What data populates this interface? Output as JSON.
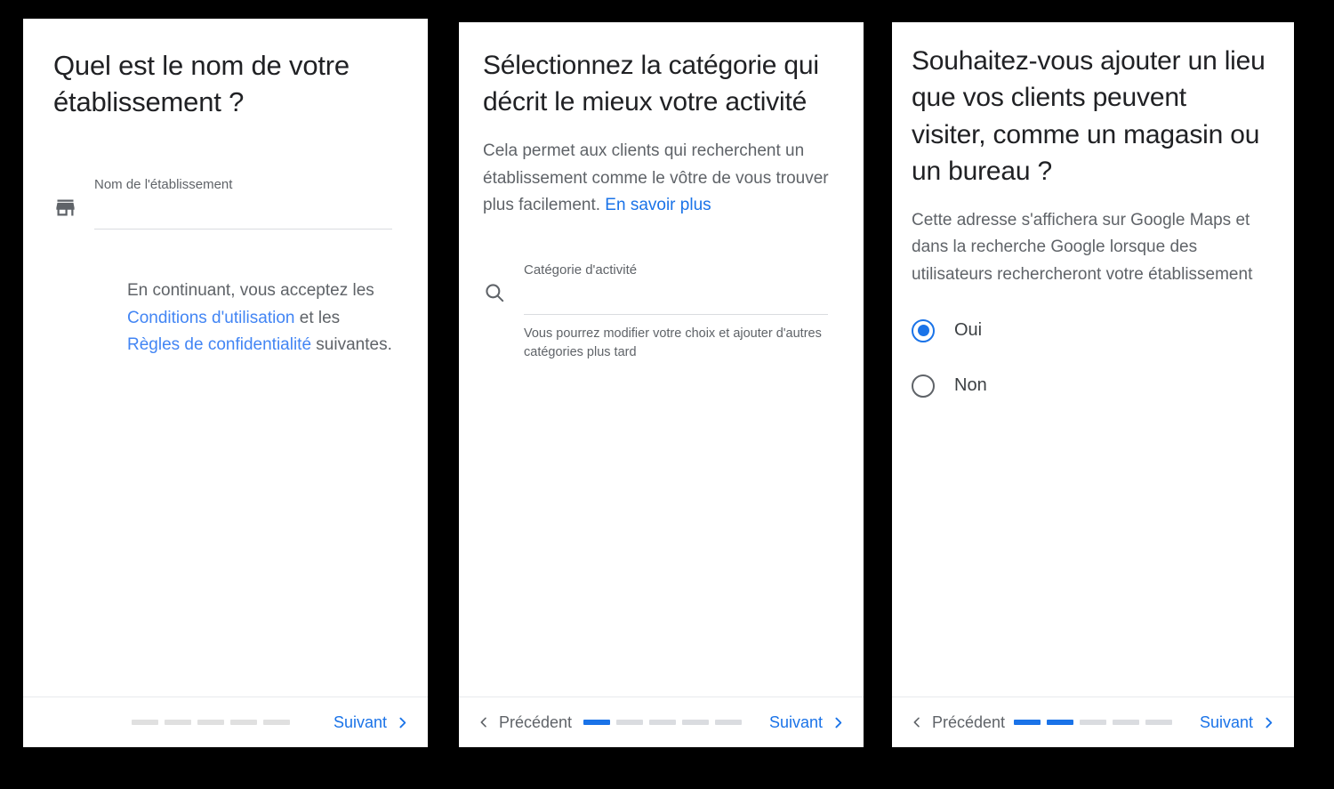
{
  "meta": {
    "background_color": "#000000",
    "card_color": "#ffffff",
    "accent_blue": "#1a73e8",
    "link_blue": "#4285f4",
    "muted_text": "#5f6368",
    "heading_text": "#202124",
    "step_inactive": "#dadce0"
  },
  "cards": [
    {
      "id": "business-name-step",
      "headline": "Quel est le nom de votre établissement ?",
      "field": {
        "icon": "storefront-icon",
        "label": "Nom de l'établissement",
        "value": "",
        "placeholder": ""
      },
      "agreement": {
        "lead": "En continuant, vous acceptez les ",
        "link1": "Conditions d'utilisation",
        "mid": " et les ",
        "link2": "Règles de confidentialité",
        "tail": " suivantes."
      },
      "footer": {
        "show_previous": false,
        "previous_label": "Précédent",
        "next_label": "Suivant",
        "steps_total": 5,
        "steps_completed": 0
      }
    },
    {
      "id": "business-category-step",
      "headline": "Sélectionnez la catégorie qui décrit le mieux votre activité",
      "subtext": {
        "body": "Cela permet aux clients qui recherchent un établissement comme le vôtre de vous trouver plus facilement. ",
        "link": "En savoir plus"
      },
      "field": {
        "icon": "search-icon",
        "label": "Catégorie d'activité",
        "value": "",
        "placeholder": "",
        "help": "Vous pourrez modifier votre choix et ajouter d'autres catégories plus tard"
      },
      "footer": {
        "show_previous": true,
        "previous_label": "Précédent",
        "next_label": "Suivant",
        "steps_total": 5,
        "steps_completed": 1
      }
    },
    {
      "id": "storefront-location-step",
      "headline": "Souhaitez-vous ajouter un lieu que vos clients peuvent visiter, comme un magasin ou un bureau ?",
      "subtext": {
        "body": "Cette adresse s'affichera sur Google Maps et dans la recherche Google lorsque des utilisateurs rechercheront votre établissement",
        "link": ""
      },
      "radios": [
        {
          "label": "Oui",
          "checked": true
        },
        {
          "label": "Non",
          "checked": false
        }
      ],
      "footer": {
        "show_previous": true,
        "previous_label": "Précédent",
        "next_label": "Suivant",
        "steps_total": 5,
        "steps_completed": 2
      }
    }
  ]
}
